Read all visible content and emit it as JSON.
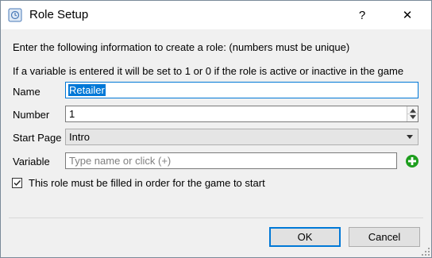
{
  "window": {
    "title": "Role Setup",
    "help_label": "?",
    "close_label": "✕"
  },
  "intro": {
    "line1": "Enter the following information to create a role: (numbers must be unique)",
    "line2": "If a variable is entered it will be set to 1 or 0 if the role is active or inactive in the game"
  },
  "form": {
    "name_label": "Name",
    "name_value": "Retailer",
    "number_label": "Number",
    "number_value": "1",
    "start_page_label": "Start Page",
    "start_page_value": "Intro",
    "variable_label": "Variable",
    "variable_placeholder": "Type name or click (+)",
    "required_label": "This role must be filled in order for the game to start",
    "required_checked": true
  },
  "buttons": {
    "ok": "OK",
    "cancel": "Cancel"
  },
  "colors": {
    "accent": "#0078d7",
    "add_icon": "#1e9e1e"
  },
  "icons": {
    "app": "role-setup-app-icon",
    "add": "plus-circle-icon",
    "check": "checkmark-icon",
    "grip": "resize-grip-icon"
  }
}
